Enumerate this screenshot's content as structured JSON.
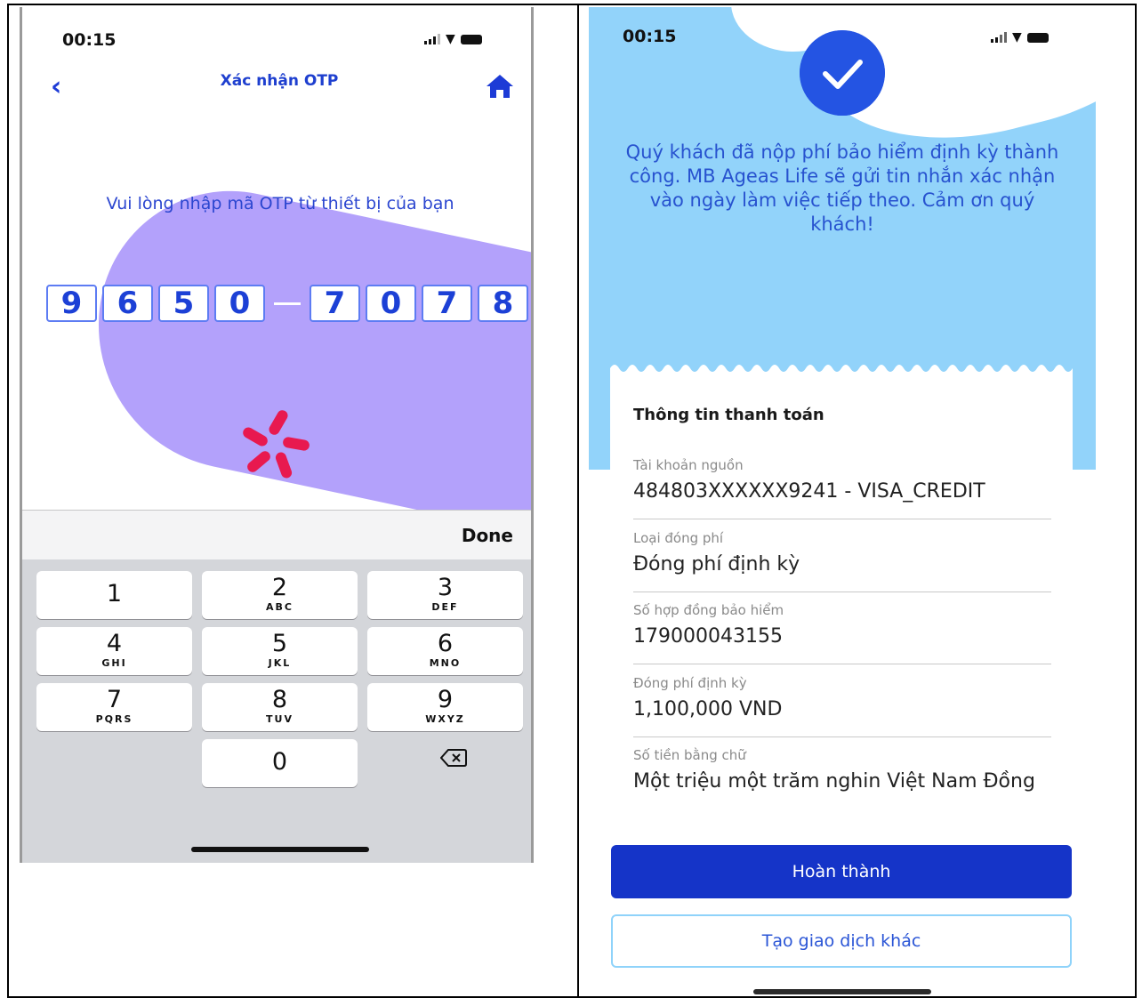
{
  "left_phone": {
    "status_time": "00:15",
    "title": "Xác nhận OTP",
    "back_icon": "chevron-left-icon",
    "home_icon": "home-icon",
    "prompt": "Vui lòng nhập mã OTP từ thiết bị của bạn",
    "otp_digits": [
      "9",
      "6",
      "5",
      "0",
      "7",
      "0",
      "7",
      "8"
    ],
    "keyboard": {
      "done_label": "Done",
      "keys": [
        {
          "num": "1",
          "letters": ""
        },
        {
          "num": "2",
          "letters": "ABC"
        },
        {
          "num": "3",
          "letters": "DEF"
        },
        {
          "num": "4",
          "letters": "GHI"
        },
        {
          "num": "5",
          "letters": "JKL"
        },
        {
          "num": "6",
          "letters": "MNO"
        },
        {
          "num": "7",
          "letters": "PQRS"
        },
        {
          "num": "8",
          "letters": "TUV"
        },
        {
          "num": "9",
          "letters": "WXYZ"
        },
        {
          "num": "0",
          "letters": ""
        }
      ],
      "delete_icon": "backspace-icon"
    },
    "colors": {
      "accent": "#1e3fcf",
      "blob": "#b3a1fb"
    }
  },
  "right_phone": {
    "status_time": "00:15",
    "check_icon": "checkmark-icon",
    "success_message": "Quý khách đã nộp phí bảo hiểm định kỳ thành công. MB Ageas Life sẽ gửi tin nhắn xác nhận vào ngày làm việc tiếp theo. Cảm ơn quý khách!",
    "receipt": {
      "title": "Thông tin thanh toán",
      "fields": [
        {
          "label": "Tài khoản nguồn",
          "value": "484803XXXXXX9241 - VISA_CREDIT"
        },
        {
          "label": "Loại đóng phí",
          "value": "Đóng phí định kỳ"
        },
        {
          "label": "Số hợp đồng bảo hiểm",
          "value": "179000043155"
        },
        {
          "label": "Đóng phí định kỳ",
          "value": "1,100,000 VND"
        },
        {
          "label": "Số tiền bằng chữ",
          "value": "Một triệu một trăm nghin Việt Nam Đồng"
        }
      ]
    },
    "primary_button": "Hoàn thành",
    "secondary_button": "Tạo giao dịch khác",
    "colors": {
      "sky": "#92d3fa",
      "primary": "#1534c8",
      "check": "#2454e3"
    }
  }
}
